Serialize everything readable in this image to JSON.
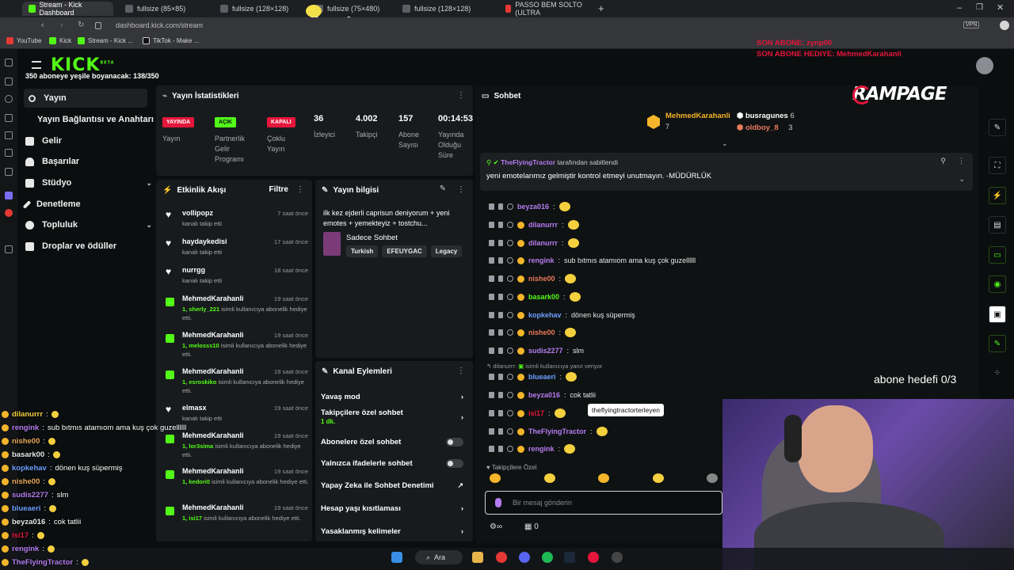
{
  "browser": {
    "tabs": [
      "Stream - Kick Dashboard",
      "fullsize (85×85)",
      "fullsize (128×128)",
      "fullsize (75×480)",
      "fullsize (128×128)",
      "PASSO BEM SOLTO (ULTRA"
    ],
    "url": "dashboard.kick.com/stream",
    "url_bold": "kick.com",
    "bookmarks": [
      "YouTube",
      "Kick",
      "Stream - Kick ...",
      "TikTok - Make ..."
    ],
    "vpn_label": "VPN",
    "tab_counts": [
      "x10",
      "x2"
    ]
  },
  "overlay": {
    "last_sub": "SON ABONE: zynp00",
    "last_gift": "SON ABONE HEDIYE: MehmedKarahanli",
    "sub_goal_bar": "350 aboneye yeşile boyanacak: 138/350",
    "sub_goal": "abone hedefi 0/3",
    "brand": "RAMPAGE"
  },
  "kick": {
    "logo": "KICK",
    "logo_sup": "BETA",
    "nav": [
      {
        "label": "Yayın",
        "icon": "broadcast-icon"
      },
      {
        "label": "Yayın Bağlantısı ve Anahtarı",
        "icon": ""
      },
      {
        "label": "Gelir",
        "icon": "wallet-icon"
      },
      {
        "label": "Başarılar",
        "icon": "trophy-icon"
      },
      {
        "label": "Stüdyo",
        "icon": "studio-icon"
      },
      {
        "label": "Denetleme",
        "icon": "wrench-icon"
      },
      {
        "label": "Topluluk",
        "icon": "community-icon"
      },
      {
        "label": "Droplar ve ödüller",
        "icon": "drops-icon"
      }
    ],
    "stats": {
      "title": "Yayın İstatistikleri",
      "items": [
        {
          "badge": "YAYINDA",
          "label": "Yayın",
          "color": "#e5163b"
        },
        {
          "badge": "AÇIK",
          "label": "Partnerlik Gelir Programı",
          "color": "#53fc18"
        },
        {
          "badge": "KAPALI",
          "label": "Çoklu Yayın",
          "color": "#e5163b"
        },
        {
          "value": "36",
          "label": "İzleyici"
        },
        {
          "value": "4.002",
          "label": "Takipçi"
        },
        {
          "value": "157",
          "label": "Abone Sayısı"
        },
        {
          "value": "00:14:53",
          "label": "Yayında Olduğu Süre"
        }
      ]
    },
    "activity": {
      "title": "Etkinlik Akışı",
      "filter": "Filtre",
      "rows": [
        {
          "name": "vollipopz",
          "time": "7 saat önce",
          "type": "follow",
          "sub": "kanalı takip etti"
        },
        {
          "name": "haydaykedisi",
          "time": "17 saat önce",
          "type": "follow",
          "sub": "kanalı takip etti"
        },
        {
          "name": "nurrgg",
          "time": "18 saat önce",
          "type": "follow",
          "sub": "kanalı takip etti"
        },
        {
          "name": "MehmedKarahanli",
          "time": "19 saat önce",
          "type": "gift",
          "count": "1,",
          "target": "sherly_221",
          "sub": "isimli kullanıcıya abonelik hediye etti."
        },
        {
          "name": "MehmedKarahanli",
          "time": "19 saat önce",
          "type": "gift",
          "count": "1,",
          "target": "melosss10",
          "sub": "isimli kullanıcıya abonelik hediye etti."
        },
        {
          "name": "MehmedKarahanli",
          "time": "19 saat önce",
          "type": "gift",
          "count": "1,",
          "target": "esroskiko",
          "sub": "isimli kullanıcıya abonelik hediye etti."
        },
        {
          "name": "elmasx",
          "time": "19 saat önce",
          "type": "follow",
          "sub": "kanalı takip etti"
        },
        {
          "name": "MehmedKarahanli",
          "time": "19 saat önce",
          "type": "gift",
          "count": "1,",
          "target": "lor3sima",
          "sub": "isimli kullanıcıya abonelik hediye etti."
        },
        {
          "name": "MehmedKarahanli",
          "time": "19 saat önce",
          "type": "gift",
          "count": "1,",
          "target": "kedori0",
          "sub": "isimli kullanıcıya abonelik hediye etti."
        },
        {
          "name": "MehmedKarahanli",
          "time": "19 saat önce",
          "type": "gift",
          "count": "1,",
          "target": "isi17",
          "sub": "isimli kullanıcıya abonelik hediye etti."
        }
      ]
    },
    "stream_info": {
      "title": "Yayın bilgisi",
      "stream_title": "ilk kez ejderli caprisun deniyorum + yeni emotes + yemekteyiz + tostchu...",
      "category": "Sadece Sohbet",
      "tags": [
        "Turkish",
        "EFEUYGAC",
        "Legacy"
      ]
    },
    "channel_actions": {
      "title": "Kanal Eylemleri",
      "items": [
        {
          "label": "Yavaş mod",
          "control": "chevron"
        },
        {
          "label": "Takipçilere özel sohbet",
          "sub": "1 dk.",
          "control": "chevron"
        },
        {
          "label": "Abonelere özel sohbet",
          "control": "toggle"
        },
        {
          "label": "Yalnızca ifadelerle sohbet",
          "control": "toggle"
        },
        {
          "label": "Yapay Zeka ile Sohbet Denetimi",
          "control": "external"
        },
        {
          "label": "Hesap yaşı kısıtlaması",
          "control": "chevron"
        },
        {
          "label": "Yasaklanmış kelimeler",
          "control": "chevron"
        }
      ]
    },
    "chat": {
      "title": "Sohbet",
      "top_gifters": [
        {
          "name": "MehmedKarahanli",
          "count": "7"
        },
        {
          "name": "busragunes",
          "count": "6"
        },
        {
          "name": "oldboy_8",
          "count": "3"
        }
      ],
      "pinned_by": "TheFlyingTractor",
      "pinned_suffix": "tarafından sabitlendi",
      "pinned_text": "yeni emotelarımız gelmiştir kontrol etmeyi unutmayın. -MÜDÜRLÜK",
      "messages": [
        {
          "user": "beyza016",
          "text": "",
          "color": "#b57cf0"
        },
        {
          "user": "dilanurrr",
          "text": "",
          "color": "#b57cf0"
        },
        {
          "user": "dilanurrr",
          "text": "",
          "color": "#b57cf0"
        },
        {
          "user": "rengink",
          "text": "sub bıtmıs atamıom ama kuş çok guzellllll",
          "color": "#b57cf0"
        },
        {
          "user": "nishe00",
          "text": "",
          "color": "#e8795b"
        },
        {
          "user": "basark00",
          "text": "",
          "color": "#53fc18"
        },
        {
          "user": "kopkehav",
          "text": "dönen kuş süpermiş",
          "color": "#6ca0ff"
        },
        {
          "user": "nishe00",
          "text": "",
          "color": "#e8795b"
        },
        {
          "user": "sudis2277",
          "text": "slm",
          "color": "#b57cf0"
        },
        {
          "user": "blueaeri",
          "text": "",
          "color": "#6ca0ff"
        },
        {
          "user": "beyza016",
          "text": "cok tatlii",
          "color": "#b57cf0"
        },
        {
          "user": "isi17",
          "text": "",
          "color": "#e5163b"
        },
        {
          "user": "TheFlyingTractor",
          "text": "",
          "color": "#b57cf0"
        },
        {
          "user": "rengink",
          "text": "",
          "color": "#b57cf0"
        }
      ],
      "reply_user": "dilanurrr:",
      "reply_text": "isimli kullanıcıya yanıt veriyor",
      "tooltip": "theflyingtractorterleyen",
      "followers_only": "Takipçilere Özel",
      "input_placeholder": "Bir mesaj gönderin",
      "footer_count": "0"
    }
  },
  "overlay_chat": [
    {
      "user": "dilanurrr",
      "text": "",
      "color": "#f4d03f"
    },
    {
      "user": "rengink",
      "text": "sub bıtmıs atamıom ama kuş çok guzellllll",
      "color": "#b57cf0"
    },
    {
      "user": "nishe00",
      "text": "",
      "color": "#e8a95b"
    },
    {
      "user": "basark00",
      "text": "",
      "color": "#e8e8e8"
    },
    {
      "user": "kopkehav",
      "text": "dönen kuş süpermiş",
      "color": "#6ca0ff"
    },
    {
      "user": "nishe00",
      "text": "",
      "color": "#e8a95b"
    },
    {
      "user": "sudis2277",
      "text": "slm",
      "color": "#b57cf0"
    },
    {
      "user": "blueaeri",
      "text": "",
      "color": "#6ca0ff"
    },
    {
      "user": "beyza016",
      "text": "cok tatlii",
      "color": "#e8e8e8"
    },
    {
      "user": "isi17",
      "text": "",
      "color": "#e5163b"
    },
    {
      "user": "rengink",
      "text": "",
      "color": "#b57cf0"
    },
    {
      "user": "TheFlyingTractor",
      "text": "",
      "color": "#b57cf0"
    }
  ],
  "taskbar": {
    "search": "Ara"
  },
  "colors": {
    "kick_green": "#53fc18",
    "live_red": "#e5163b",
    "panel": "#181b1d"
  }
}
